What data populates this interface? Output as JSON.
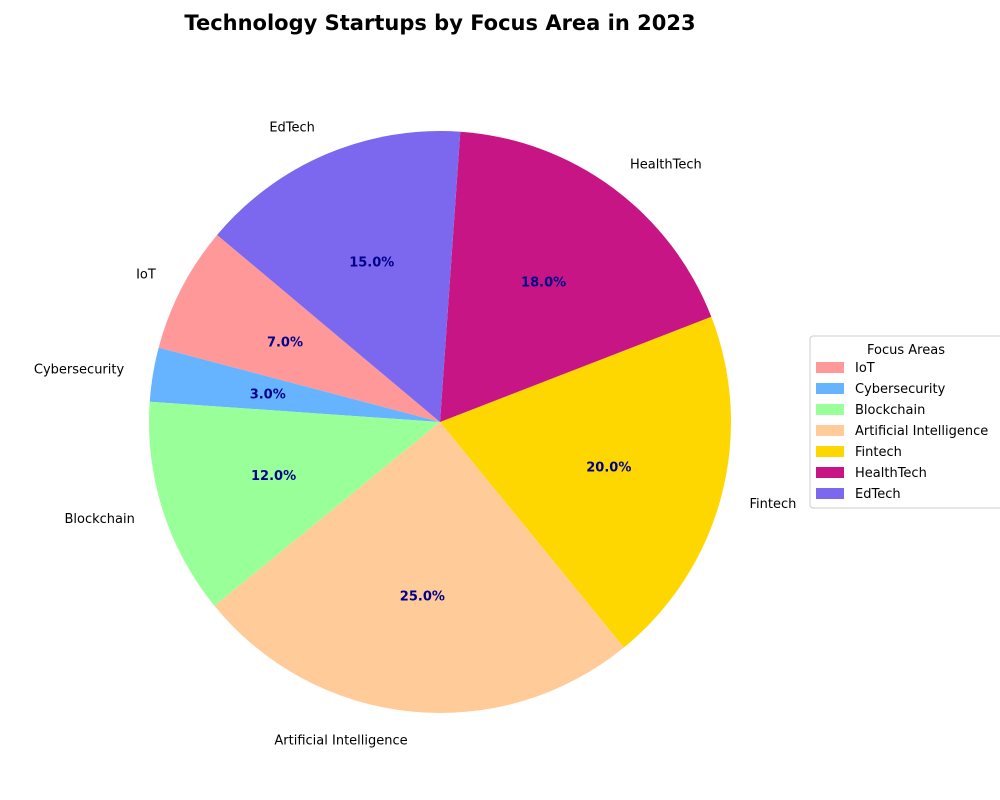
{
  "chart_data": {
    "type": "pie",
    "title": "Technology Startups by Focus Area in 2023",
    "categories": [
      "IoT",
      "Cybersecurity",
      "Blockchain",
      "Artificial Intelligence",
      "Fintech",
      "HealthTech",
      "EdTech"
    ],
    "values": [
      7.0,
      3.0,
      12.0,
      25.0,
      20.0,
      18.0,
      15.0
    ],
    "value_labels": [
      "7.0%",
      "3.0%",
      "12.0%",
      "25.0%",
      "20.0%",
      "18.0%",
      "15.0%"
    ],
    "colors": [
      "#ff9999",
      "#66b3ff",
      "#99ff99",
      "#ffcc99",
      "#ffd700",
      "#c71585",
      "#7b68ee"
    ],
    "start_angle_deg": 140,
    "direction": "counterclockwise",
    "legend": {
      "title": "Focus Areas",
      "placement": "right"
    }
  }
}
